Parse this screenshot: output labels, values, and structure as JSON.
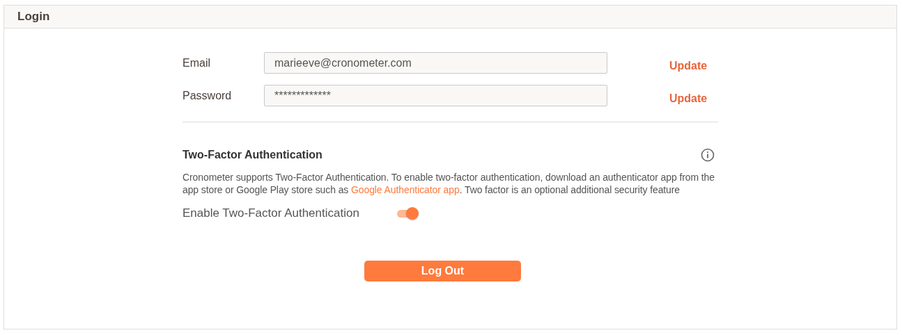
{
  "panel": {
    "title": "Login"
  },
  "fields": [
    {
      "label": "Email",
      "value": "marieeve@cronometer.com",
      "action": "Update"
    },
    {
      "label": "Password",
      "value": "*************",
      "action": "Update"
    }
  ],
  "two_factor": {
    "heading": "Two-Factor Authentication",
    "description_before": "Cronometer supports Two-Factor Authentication. To enable two-factor authentication, download an authenticator app from the app store or Google Play store such as ",
    "link": "Google Authenticator app",
    "description_after": ". Two factor is an optional additional security feature",
    "toggle_label": "Enable Two-Factor Authentication",
    "on": true
  },
  "button": "Log Out"
}
